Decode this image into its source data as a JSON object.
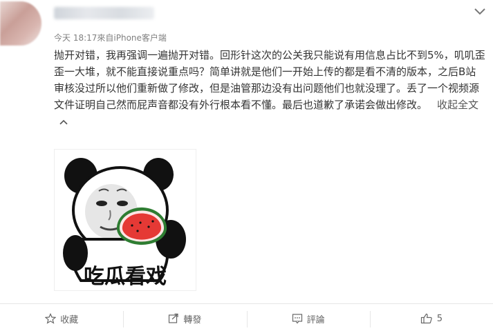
{
  "post": {
    "meta": "今天 18:17來自iPhone客户端",
    "body": "抛开对错，我再强调一遍抛开对错。回形针这次的公关我只能说有用信息占比不到5%，叽叽歪歪一大堆，就不能直接说重点吗？简单讲就是他们一开始上传的都是看不清的版本，之后B站审核没过所以他们重新做了修改，但是油管那边没有出问题他们也就没理了。丢了一个视频源文件证明自己然而屁声音都没有外行根本看不懂。最后也道歉了承诺会做出修改。",
    "collapse_label": "收起全文",
    "image_caption": "吃瓜看戏"
  },
  "actions": {
    "favorite": "收藏",
    "repost": "轉發",
    "comment": "評論",
    "like_count": "5"
  },
  "colors": {
    "text": "#333333",
    "meta": "#808080",
    "divider": "#e6e6e6"
  }
}
